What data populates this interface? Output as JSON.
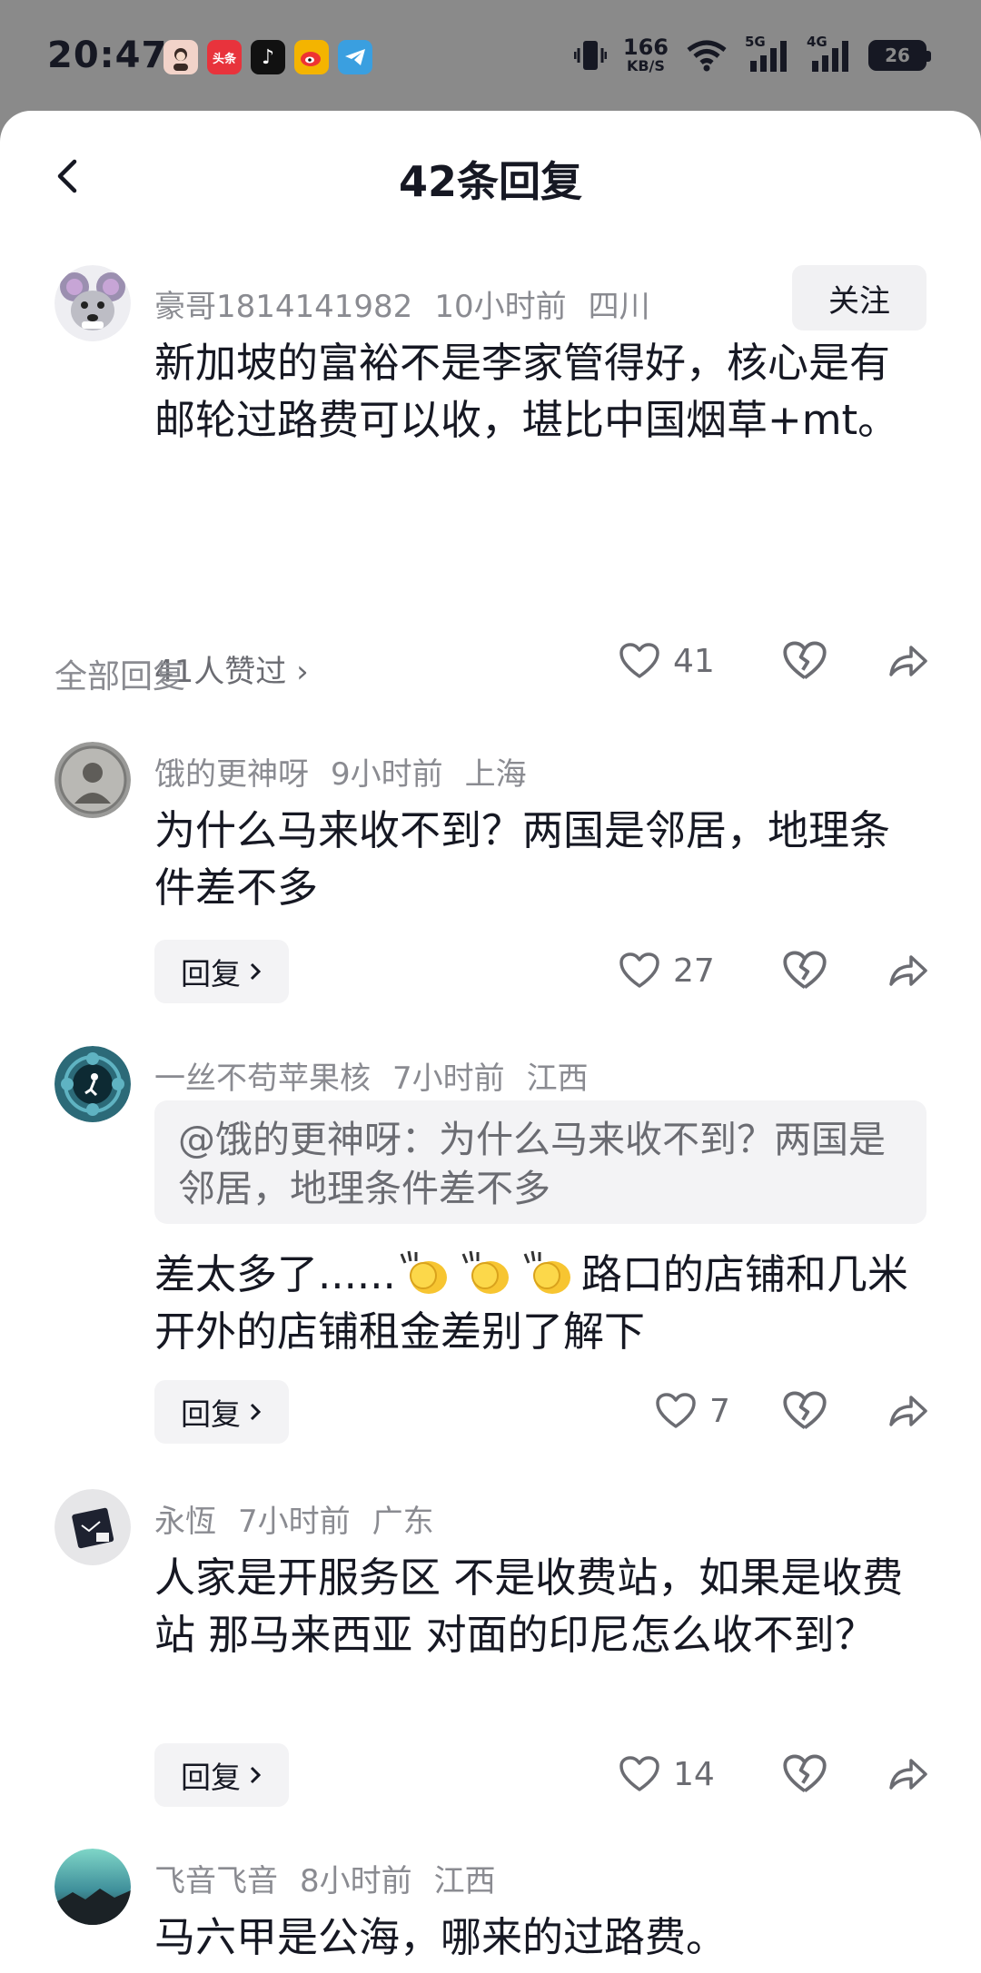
{
  "status_bar": {
    "time": "20:47",
    "apps": [
      {
        "name": "avatar-app-icon",
        "label": "",
        "color": "#f2d3c9"
      },
      {
        "name": "toutiao-icon",
        "label": "头条",
        "color": "#e8333c"
      },
      {
        "name": "tiktok-icon",
        "label": "♪",
        "color": "#111111"
      },
      {
        "name": "weibo-icon",
        "label": "●",
        "color": "#f4b400"
      },
      {
        "name": "telegram-icon",
        "label": "➤",
        "color": "#3a9fe0"
      }
    ],
    "net_speed": "166",
    "net_unit": "KB/S",
    "signal_5g": "5G",
    "signal_4g": "4G",
    "battery": "26"
  },
  "header": {
    "title": "42条回复"
  },
  "main_comment": {
    "username": "豪哥1814141982",
    "time": "10小时前",
    "location": "四川",
    "follow_label": "关注",
    "text": "新加坡的富裕不是李家管得好，核心是有邮轮过路费可以收，堪比中国烟草+mt。",
    "likes_link": "41人赞过 ›",
    "like_count": "41"
  },
  "section_label": "全部回复",
  "replies": [
    {
      "username": "饿的更神呀",
      "time": "9小时前",
      "location": "上海",
      "text": "为什么马来收不到？两国是邻居，地理条件差不多",
      "reply_label": "回复",
      "like_count": "27"
    },
    {
      "username": "一丝不苟苹果核",
      "time": "7小时前",
      "location": "江西",
      "quote": "@饿的更神呀：为什么马来收不到？两国是邻居，地理条件差不多",
      "text_before": "差太多了......",
      "text_after": "路口的店铺和几米开外的店铺租金差别了解下",
      "reply_label": "回复",
      "like_count": "7"
    },
    {
      "username": "永恆",
      "time": "7小时前",
      "location": "广东",
      "text": "人家是开服务区 不是收费站，如果是收费站 那马来西亚 对面的印尼怎么收不到？",
      "reply_label": "回复",
      "like_count": "14"
    },
    {
      "username": "飞音飞音",
      "time": "8小时前",
      "location": "江西",
      "text": "马六甲是公海，哪来的过路费。"
    }
  ]
}
